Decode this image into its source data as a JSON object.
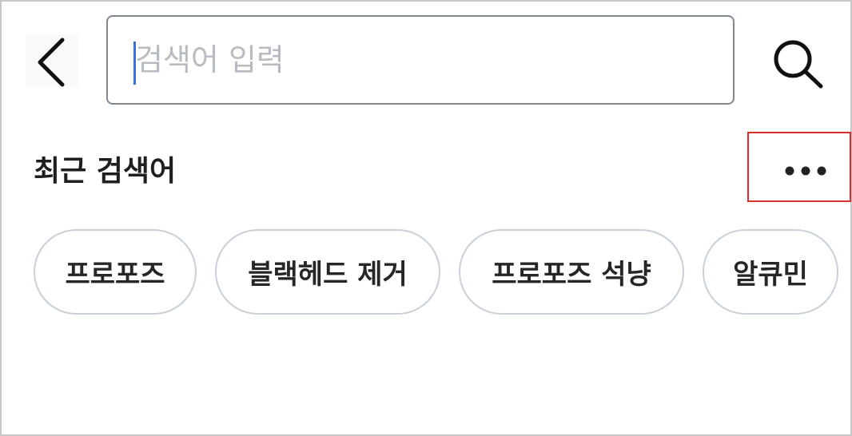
{
  "search": {
    "placeholder": "검색어 입력",
    "value": ""
  },
  "icons": {
    "back": "chevron-left-icon",
    "search": "magnifier-icon",
    "more": "more-horizontal-icon"
  },
  "recent": {
    "title": "최근 검색어",
    "items": [
      {
        "label": "프로포즈"
      },
      {
        "label": "블랙헤드 제거"
      },
      {
        "label": "프로포즈 석냥"
      },
      {
        "label": "알큐민"
      }
    ]
  },
  "colors": {
    "highlight_border": "#d92e2e",
    "caret": "#3a6fd8",
    "chip_border": "#c9d0d8",
    "input_border": "#7f8790",
    "placeholder": "#b7bcc3"
  }
}
